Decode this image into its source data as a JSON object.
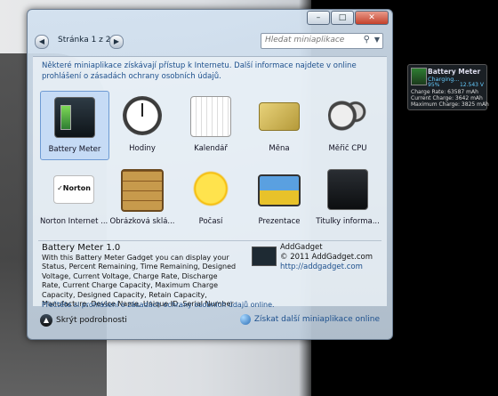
{
  "window": {
    "buttons": {
      "minimize": "–",
      "maximize": "□",
      "close": "✕"
    }
  },
  "toolbar": {
    "prev_icon": "◀",
    "next_icon": "▶",
    "page_label": "Stránka 1 z 2",
    "search_placeholder": "Hledat miniaplikace"
  },
  "info_text": "Některé miniaplikace získávají přístup k Internetu. Další informace najdete v online prohlášení o zásadách ochrany osobních údajů.",
  "gadgets": [
    {
      "label": "Battery Meter",
      "icon": "battery-icon",
      "selected": true
    },
    {
      "label": "Hodiny",
      "icon": "clock-icon",
      "selected": false
    },
    {
      "label": "Kalendář",
      "icon": "calendar-icon",
      "selected": false
    },
    {
      "label": "Měna",
      "icon": "currency-icon",
      "selected": false
    },
    {
      "label": "Měřič CPU",
      "icon": "cpu-meter-icon",
      "selected": false
    },
    {
      "label": "Norton Internet ...",
      "icon": "norton-icon",
      "selected": false
    },
    {
      "label": "Obrázková sklá...",
      "icon": "picture-puzzle-icon",
      "selected": false
    },
    {
      "label": "Počasí",
      "icon": "weather-icon",
      "selected": false
    },
    {
      "label": "Prezentace",
      "icon": "slideshow-icon",
      "selected": false
    },
    {
      "label": "Titulky informa...",
      "icon": "headlines-icon",
      "selected": false
    }
  ],
  "details": {
    "title": "Battery Meter 1.0",
    "description": "With this Battery Meter Gadget you can display your Status, Percent Remaining, Time Remaining, Designed Voltage, Current Voltage, Charge Rate, Discharge Rate, Current Charge Capacity, Maximum Charge Capacity, Designed Capacity, Retain Capacity, Manufacture, Device Name, Unique ID, Serial Number",
    "privacy_link": "Přečtěte si prohlášení o zásadách ochrany osobních údajů online.",
    "publisher": "AddGadget",
    "copyright": "© 2011 AddGadget.com",
    "url": "http://addgadget.com"
  },
  "footer": {
    "hide_details": "Skrýt podrobnosti",
    "more_online": "Získat další miniaplikace online"
  },
  "desktop_gadget": {
    "title": "Battery Meter",
    "status": "Charging...",
    "percent": "95%",
    "voltage": "12.543 V",
    "charge_rate": "Charge Rate: 63587 mAh",
    "current_charge": "Current Charge: 3642 mAh",
    "maximum_charge": "Maximum Charge: 3825 mAh"
  }
}
